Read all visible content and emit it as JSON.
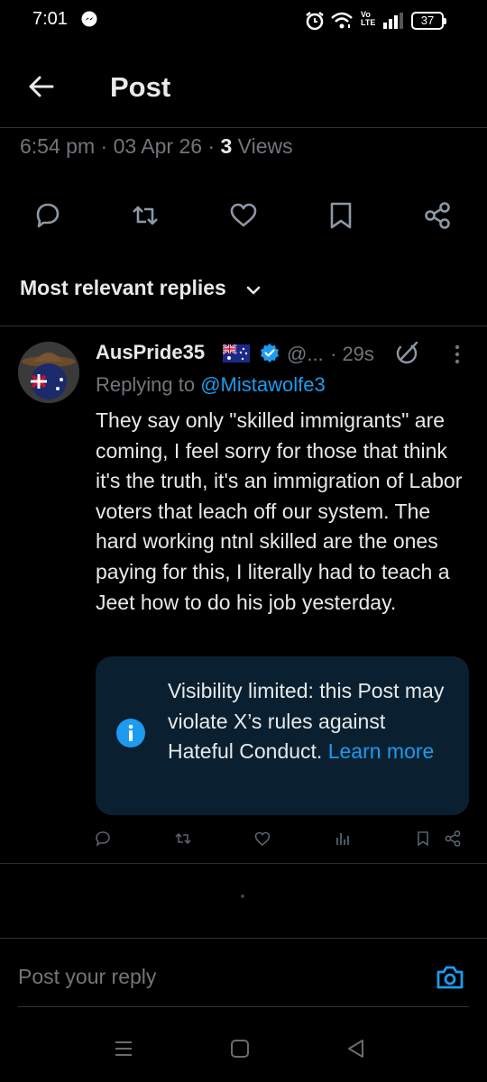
{
  "status_bar": {
    "time": "7:01",
    "volte_top": "Vo",
    "volte_bottom": "LTE",
    "battery": "37"
  },
  "header": {
    "title": "Post"
  },
  "post_meta": {
    "time": "6:54 pm",
    "date": "03 Apr 26",
    "views_count": "3",
    "views_label": "Views",
    "separator": "·"
  },
  "actions": [
    "reply-icon",
    "repost-icon",
    "like-icon",
    "bookmark-icon",
    "share-icon"
  ],
  "replies_sort": {
    "label": "Most relevant replies"
  },
  "reply": {
    "display_name": "AusPride35",
    "handle": "@...",
    "time": "· 29s",
    "replying_prefix": "Replying to",
    "replying_to": "@Mistawolfe3",
    "body": "They say only \"skilled immigrants\" are coming, I feel sorry for those that think it's the truth, it's an immigration of Labor voters that leach off our system. The hard working ntnl skilled are the ones paying for this, I literally had to teach a Jeet how to do his job yesterday.",
    "notice": {
      "text": "Visibility limited: this Post may violate X’s rules against Hateful Conduct.",
      "link": "Learn more"
    }
  },
  "composer": {
    "placeholder": "Post your reply"
  },
  "colors": {
    "accent": "#1d9bf0",
    "muted": "#71767b",
    "text": "#e7e9ea",
    "notice_bg": "#0a2030",
    "divider": "#2f3336"
  }
}
